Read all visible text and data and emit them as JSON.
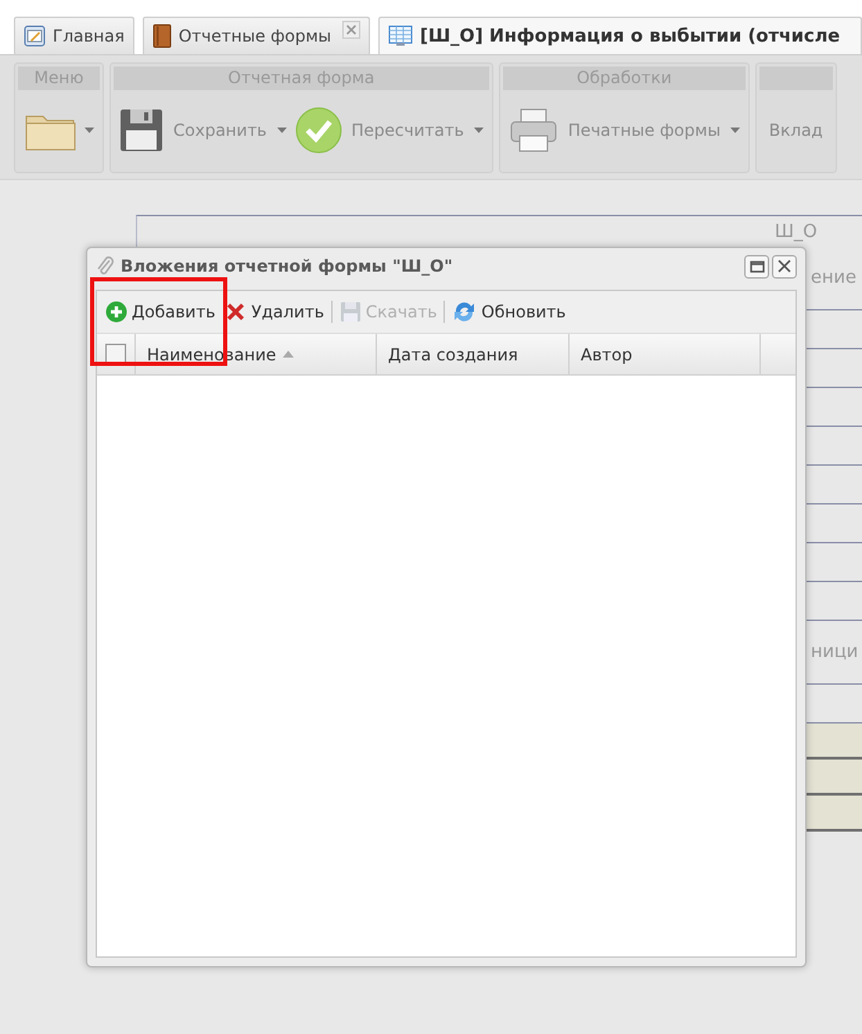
{
  "tabs": [
    {
      "label": "Главная",
      "selected": false,
      "closable": false
    },
    {
      "label": "Отчетные формы",
      "selected": false,
      "closable": true
    },
    {
      "label": "[Ш_О] Информация о выбытии (отчисле",
      "selected": true,
      "closable": false
    }
  ],
  "toolbar": [
    {
      "title": "Меню",
      "buttons": [
        {
          "dropdown": true
        }
      ]
    },
    {
      "title": "Отчетная форма",
      "buttons": [
        {
          "label": "Сохранить",
          "dropdown": true
        },
        {
          "label": "Пересчитать",
          "dropdown": true
        }
      ]
    },
    {
      "title": "Обработки",
      "buttons": [
        {
          "label": "Печатные формы",
          "dropdown": true
        }
      ]
    },
    {
      "buttons": [
        {
          "label": "Вклад",
          "dropdown": false
        }
      ]
    }
  ],
  "form": {
    "rows": [
      {
        "kind": "plain",
        "text": "Ш_О"
      },
      {
        "kind": "plain",
        "text": "ение"
      },
      {
        "kind": "plain"
      },
      {
        "kind": "plain"
      },
      {
        "kind": "plain"
      },
      {
        "kind": "plain"
      },
      {
        "kind": "plain"
      },
      {
        "kind": "plain"
      },
      {
        "kind": "plain"
      },
      {
        "kind": "plain"
      },
      {
        "kind": "plain",
        "text": "ници"
      },
      {
        "kind": "plain"
      },
      {
        "kind": "shaded"
      },
      {
        "kind": "shaded"
      },
      {
        "kind": "shaded"
      }
    ]
  },
  "dialog": {
    "title": "Вложения отчетной формы \"Ш_О\"",
    "buttons": [
      {
        "label": "Добавить",
        "disabled": false,
        "highlighted": true
      },
      {
        "label": "Удалить",
        "disabled": false,
        "highlighted": false
      },
      {
        "label": "Скачать",
        "disabled": true,
        "highlighted": false
      },
      {
        "label": "Обновить",
        "disabled": false,
        "highlighted": false
      }
    ],
    "select_all": {
      "checked": false
    },
    "columns": [
      {
        "label": "Наименование",
        "sorted": true
      },
      {
        "label": "Дата создания",
        "sorted": false
      },
      {
        "label": "Автор",
        "sorted": false
      }
    ]
  }
}
